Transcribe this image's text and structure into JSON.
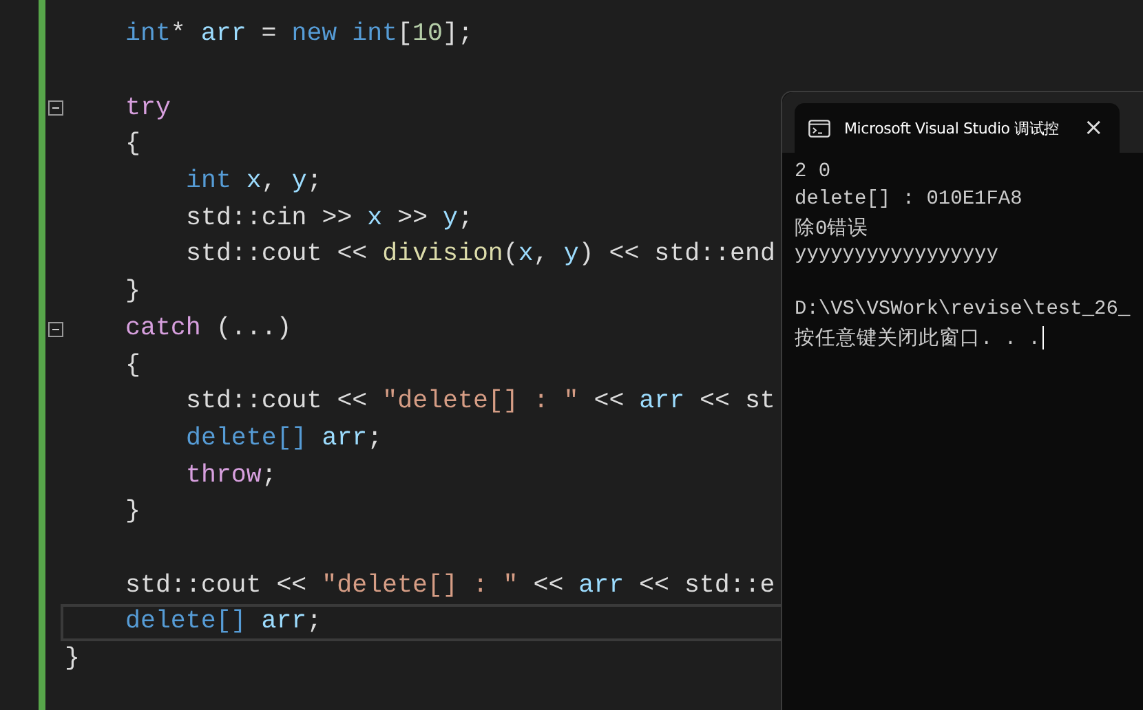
{
  "editor": {
    "body": [
      {
        "fold": false,
        "current": false,
        "tokens": [
          {
            "text": "int",
            "kind": "keyword"
          },
          {
            "text": "* ",
            "kind": "plain"
          },
          {
            "text": "arr",
            "kind": "variable"
          },
          {
            "text": " = ",
            "kind": "plain"
          },
          {
            "text": "new",
            "kind": "keyword"
          },
          {
            "text": " int",
            "kind": "keyword"
          },
          {
            "text": "[",
            "kind": "plain"
          },
          {
            "text": "10",
            "kind": "number"
          },
          {
            "text": "];",
            "kind": "plain"
          }
        ]
      },
      {
        "fold": false,
        "current": false
      },
      {
        "fold": true,
        "current": false,
        "tokens": [
          {
            "text": "try",
            "kind": "control"
          }
        ]
      },
      {
        "fold": false,
        "current": false,
        "tokens": [
          {
            "text": "{",
            "kind": "plain"
          }
        ],
        "children": [
          {
            "fold": false,
            "current": false,
            "tokens": [
              {
                "text": "int",
                "kind": "keyword"
              },
              {
                "text": " x",
                "kind": "variable"
              },
              {
                "text": ", ",
                "kind": "plain"
              },
              {
                "text": "y",
                "kind": "variable"
              },
              {
                "text": ";",
                "kind": "plain"
              }
            ]
          },
          {
            "fold": false,
            "current": false,
            "tokens": [
              {
                "text": "std::cin >> ",
                "kind": "plain"
              },
              {
                "text": "x",
                "kind": "variable"
              },
              {
                "text": " >> ",
                "kind": "plain"
              },
              {
                "text": "y",
                "kind": "variable"
              },
              {
                "text": ";",
                "kind": "plain"
              }
            ]
          },
          {
            "fold": false,
            "current": false,
            "tokens": [
              {
                "text": "std::cout << ",
                "kind": "plain"
              },
              {
                "text": "division",
                "kind": "function"
              },
              {
                "text": "(",
                "kind": "plain"
              },
              {
                "text": "x",
                "kind": "variable"
              },
              {
                "text": ", ",
                "kind": "plain"
              },
              {
                "text": "y",
                "kind": "variable"
              },
              {
                "text": ") << std::end",
                "kind": "plain"
              }
            ]
          }
        ]
      },
      {
        "fold": false,
        "current": false,
        "tokens": [
          {
            "text": "}",
            "kind": "plain"
          }
        ]
      },
      {
        "fold": true,
        "current": false,
        "tokens": [
          {
            "text": "catch",
            "kind": "control"
          },
          {
            "text": " (...)",
            "kind": "plain"
          }
        ]
      },
      {
        "fold": false,
        "current": false,
        "tokens": [
          {
            "text": "{",
            "kind": "plain"
          }
        ],
        "children": [
          {
            "fold": false,
            "current": false,
            "tokens": [
              {
                "text": "std::cout << ",
                "kind": "plain"
              },
              {
                "text": "\"delete[] : \"",
                "kind": "string"
              },
              {
                "text": " << ",
                "kind": "plain"
              },
              {
                "text": "arr",
                "kind": "variable"
              },
              {
                "text": " << st",
                "kind": "plain"
              }
            ]
          },
          {
            "fold": false,
            "current": false,
            "tokens": [
              {
                "text": "delete[]",
                "kind": "keyword"
              },
              {
                "text": " arr",
                "kind": "variable"
              },
              {
                "text": ";",
                "kind": "plain"
              }
            ]
          },
          {
            "fold": false,
            "current": false,
            "tokens": [
              {
                "text": "throw",
                "kind": "control"
              },
              {
                "text": ";",
                "kind": "plain"
              }
            ]
          }
        ]
      },
      {
        "fold": false,
        "current": false,
        "tokens": [
          {
            "text": "}",
            "kind": "plain"
          }
        ]
      },
      {
        "fold": false,
        "current": false
      },
      {
        "fold": false,
        "current": false,
        "tokens": [
          {
            "text": "std::cout << ",
            "kind": "plain"
          },
          {
            "text": "\"delete[] : \"",
            "kind": "string"
          },
          {
            "text": " << ",
            "kind": "plain"
          },
          {
            "text": "arr",
            "kind": "variable"
          },
          {
            "text": " << std::e",
            "kind": "plain"
          }
        ]
      },
      {
        "fold": false,
        "current": true,
        "tokens": [
          {
            "text": "delete[]",
            "kind": "keyword"
          },
          {
            "text": " arr",
            "kind": "variable"
          },
          {
            "text": ";",
            "kind": "plain"
          }
        ]
      }
    ],
    "closing": {
      "tokens": [
        {
          "text": "}"
        }
      ]
    }
  },
  "console": {
    "tab": {
      "title": "Microsoft Visual Studio 调试控",
      "close": "×"
    },
    "output": [
      "2 0",
      "delete[] : 010E1FA8",
      "除0错误",
      "yyyyyyyyyyyyyyyyy"
    ],
    "prompt": [
      "D:\\VS\\VSWork\\revise\\test_26_",
      "按任意键关闭此窗口. . ."
    ],
    "cursor": true
  }
}
